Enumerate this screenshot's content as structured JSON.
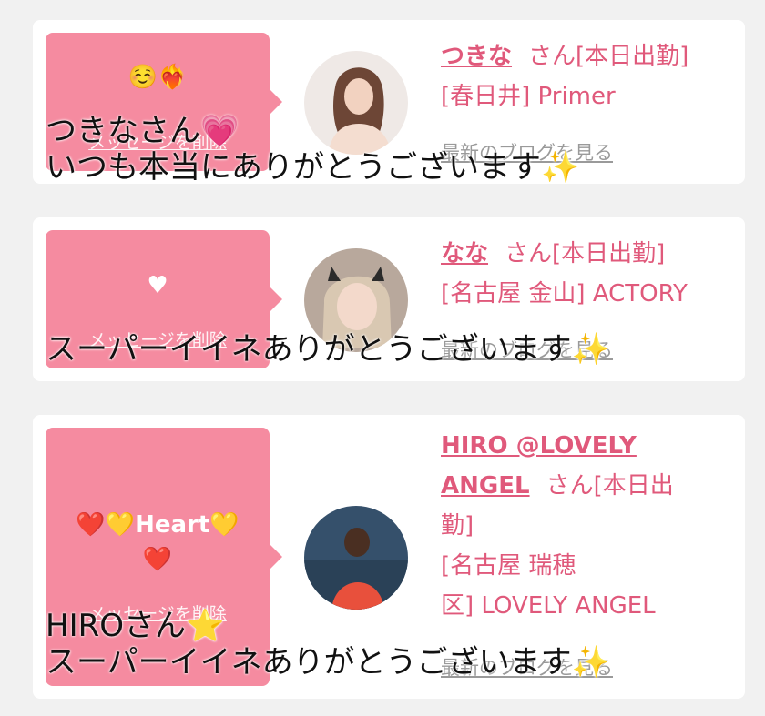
{
  "cards": [
    {
      "bubble_message": "☺️❤️‍🔥",
      "delete_label": "メッセージを削除",
      "sender_name": "つきな",
      "san_label": "さん[本日出勤]",
      "shop_line": "[春日井] Primer",
      "blog_label": "最新のブログを見る",
      "overlay_lines": [
        "つきなさん💗",
        "いつも本当にありがとうございます✨"
      ]
    },
    {
      "bubble_message": "♥",
      "delete_label": "メッセージを削除",
      "sender_name": "なな",
      "san_label": "さん[本日出勤]",
      "shop_line": "[名古屋 金山] ACTORY",
      "blog_label": "最新のブログを見る",
      "overlay_lines": [
        "スーパーイイネありがとうございます✨"
      ]
    },
    {
      "bubble_message_line1": "❤️💛Heart💛",
      "bubble_message_line2": "❤️",
      "delete_label": "メッセージを削除",
      "sender_name_line1": "HIRO @LOVELY",
      "sender_name_line2": "ANGEL",
      "san_label_line1": "さん[本日出",
      "san_label_line2": "勤]",
      "shop_line1": "[名古屋 瑞穂",
      "shop_line2": "区] LOVELY ANGEL",
      "blog_label": "最新のブログを見る",
      "overlay_lines": [
        "HIROさん⭐",
        "スーパーイイネありがとうございます✨"
      ]
    }
  ],
  "colors": {
    "background": "#f1f1f1",
    "card": "#ffffff",
    "bubble": "#f58ba0",
    "accent_text": "#e0597b",
    "muted_text": "#9a9a9a"
  }
}
